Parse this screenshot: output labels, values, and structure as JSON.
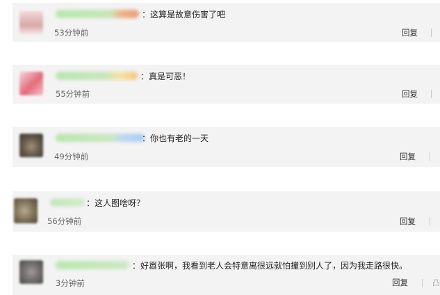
{
  "comments": [
    {
      "text": "：这算是故意伤害了吧",
      "time": "53分钟前",
      "reply": "回复"
    },
    {
      "text": "：真是可恶！",
      "time": "55分钟前",
      "reply": "回复"
    },
    {
      "text": "：你也有老的一天",
      "time": "49分钟前",
      "reply": "回复"
    },
    {
      "text": "：这人图啥呀？",
      "time": "56分钟前",
      "reply": "回复"
    },
    {
      "text": "：好嚣张啊，我看到老人会特意离很远就怕撞到别人了，因为我走路很快。",
      "time": "3分钟前",
      "reply": "回复"
    }
  ],
  "colors": {
    "card_bg": "#f3f3f3",
    "text": "#222222",
    "time": "#666666"
  }
}
